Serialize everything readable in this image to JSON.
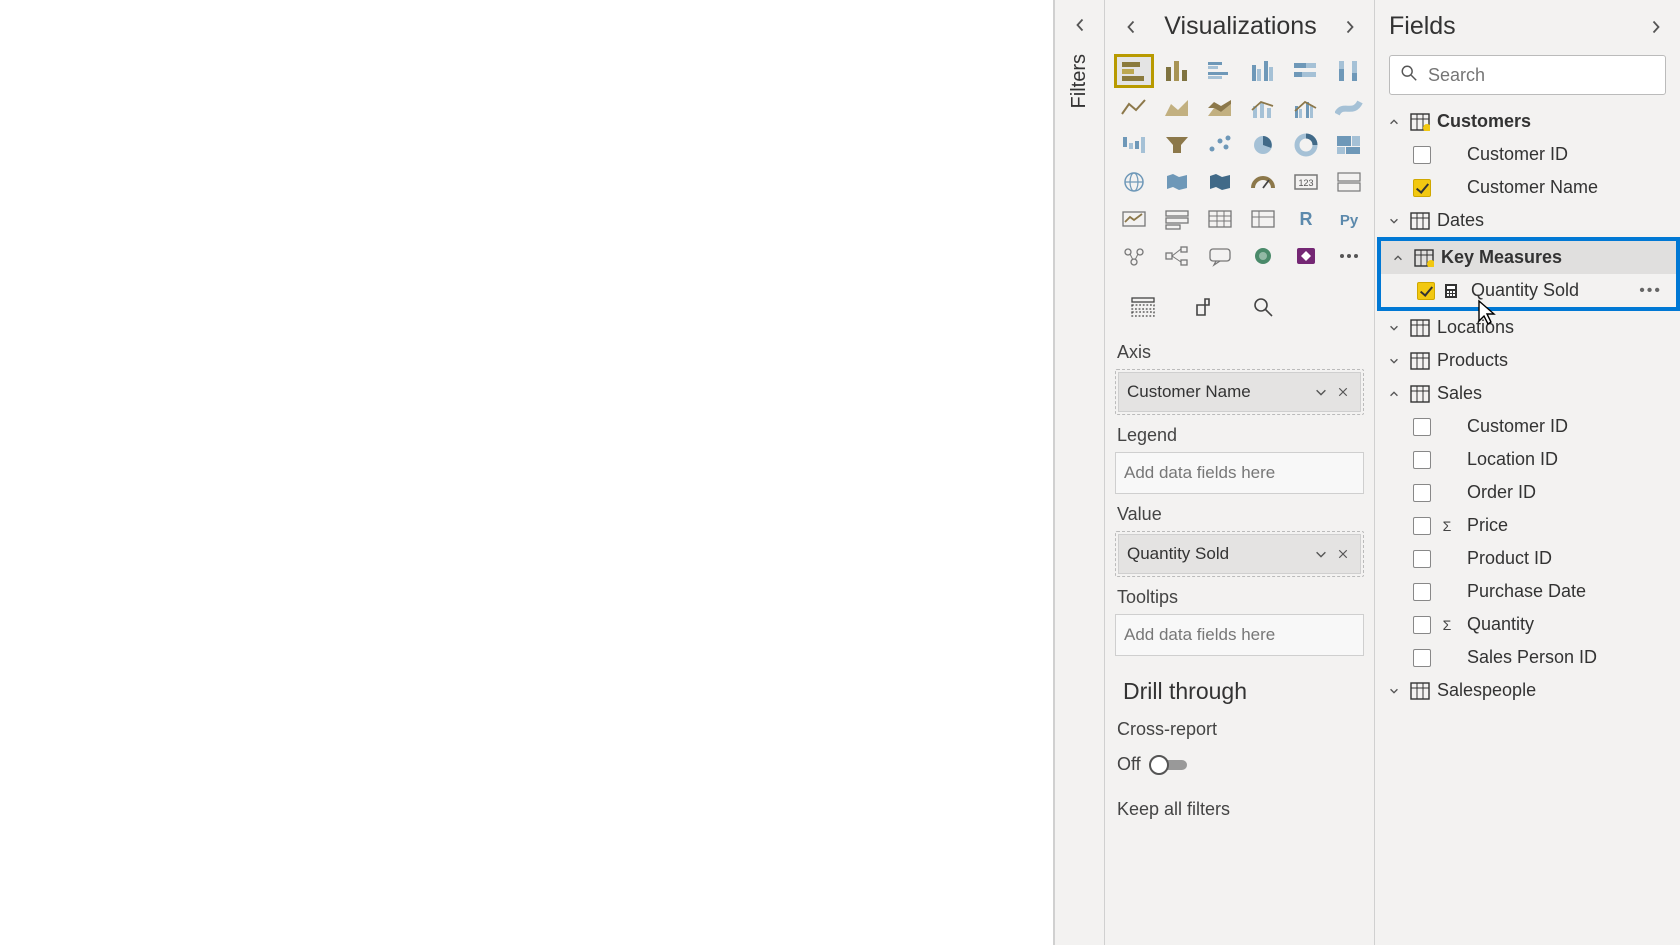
{
  "filters": {
    "label": "Filters"
  },
  "visualizations": {
    "title": "Visualizations",
    "wells": {
      "axis_label": "Axis",
      "axis_pill": "Customer Name",
      "legend_label": "Legend",
      "legend_placeholder": "Add data fields here",
      "value_label": "Value",
      "value_pill": "Quantity Sold",
      "tooltips_label": "Tooltips",
      "tooltips_placeholder": "Add data fields here"
    },
    "drill": {
      "title": "Drill through",
      "cross_report": "Cross-report",
      "off": "Off",
      "keep_filters": "Keep all filters"
    }
  },
  "fields": {
    "title": "Fields",
    "search_placeholder": "Search",
    "tables": {
      "customers": {
        "name": "Customers",
        "fields": {
          "customer_id": "Customer ID",
          "customer_name": "Customer Name"
        }
      },
      "dates": {
        "name": "Dates"
      },
      "key_measures": {
        "name": "Key Measures",
        "fields": {
          "quantity_sold": "Quantity Sold"
        }
      },
      "locations": {
        "name": "Locations"
      },
      "products": {
        "name": "Products"
      },
      "sales": {
        "name": "Sales",
        "fields": {
          "customer_id": "Customer ID",
          "location_id": "Location ID",
          "order_id": "Order ID",
          "price": "Price",
          "product_id": "Product ID",
          "purchase_date": "Purchase Date",
          "quantity": "Quantity",
          "sales_person_id": "Sales Person ID"
        }
      },
      "salespeople": {
        "name": "Salespeople"
      }
    }
  }
}
